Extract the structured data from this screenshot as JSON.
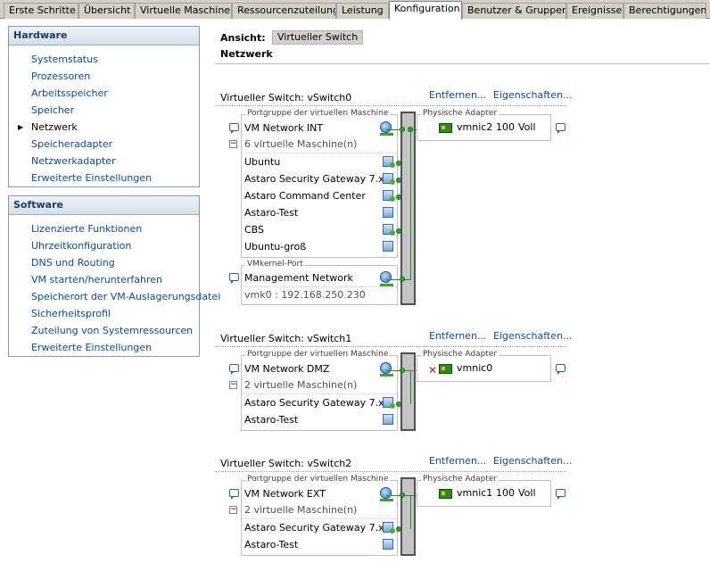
{
  "tabs": [
    "Erste Schritte",
    "Übersicht",
    "Virtuelle Maschinen",
    "Ressourcenzuteilung",
    "Leistung",
    "Konfiguration",
    "Benutzer & Gruppen",
    "Ereignisse",
    "Berechtigungen"
  ],
  "active_tab": "Konfiguration",
  "hardware": {
    "title": "Hardware",
    "items": [
      "Systemstatus",
      "Prozessoren",
      "Arbeitsspeicher",
      "Speicher",
      "Netzwerk",
      "Speicheradapter",
      "Netzwerkadapter",
      "Erweiterte Einstellungen"
    ],
    "selected": "Netzwerk"
  },
  "software": {
    "title": "Software",
    "items": [
      "Lizenzierte Funktionen",
      "Uhrzeitkonfiguration",
      "DNS und Routing",
      "VM starten/herunterfahren",
      "Speicherort der VM-Auslagerungsdatei",
      "Sicherheitsprofil",
      "Zuteilung von Systemressourcen",
      "Erweiterte Einstellungen"
    ]
  },
  "view": {
    "label": "Ansicht:",
    "button": "Virtueller Switch",
    "section": "Netzwerk"
  },
  "switches": [
    {
      "title": "Virtueller Switch: vSwitch0",
      "remove": "Entfernen...",
      "properties": "Eigenschaften...",
      "portgroup_caption": "Portgruppe der virtuellen Maschine",
      "portgroup_name": "VM Network INT",
      "vm_count": "6 virtuelle Maschine(n)",
      "vms": [
        "Ubuntu",
        "Astaro Security Gateway 7.x",
        "Astaro Command Center",
        "Astaro-Test",
        "CBS",
        "Ubuntu-groß"
      ],
      "vm_powered_on": [
        true,
        true,
        true,
        false,
        true,
        false
      ],
      "vmkernel_caption": "VMkernel-Port",
      "vmkernel_name": "Management Network",
      "vmkernel_ip": "vmk0 : 192.168.250.230",
      "adapter_caption": "Physische Adapter",
      "adapter_name": "vmnic2",
      "adapter_speed": "100",
      "adapter_duplex": "Voll",
      "adapter_connected": true
    },
    {
      "title": "Virtueller Switch: vSwitch1",
      "remove": "Entfernen...",
      "properties": "Eigenschaften...",
      "portgroup_caption": "Portgruppe der virtuellen Maschine",
      "portgroup_name": "VM Network DMZ",
      "vm_count": "2 virtuelle Maschine(n)",
      "vms": [
        "Astaro Security Gateway 7.x",
        "Astaro-Test"
      ],
      "vm_powered_on": [
        true,
        false
      ],
      "adapter_caption": "Physische Adapter",
      "adapter_name": "vmnic0",
      "adapter_connected": false
    },
    {
      "title": "Virtueller Switch: vSwitch2",
      "remove": "Entfernen...",
      "properties": "Eigenschaften...",
      "portgroup_caption": "Portgruppe der virtuellen Maschine",
      "portgroup_name": "VM Network EXT",
      "vm_count": "2 virtuelle Maschine(n)",
      "vms": [
        "Astaro Security Gateway 7.x",
        "Astaro-Test"
      ],
      "vm_powered_on": [
        true,
        false
      ],
      "adapter_caption": "Physische Adapter",
      "adapter_name": "vmnic1",
      "adapter_speed": "100",
      "adapter_duplex": "Voll",
      "adapter_connected": true
    }
  ],
  "colors": {
    "link": "#0a4aa3",
    "panel_title": "#1c3a6a",
    "wire": "#2c8b22",
    "error": "#c0201a"
  }
}
